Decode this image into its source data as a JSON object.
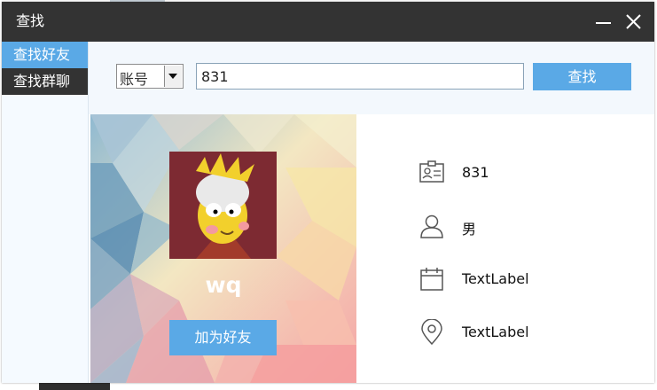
{
  "window": {
    "title": "查找"
  },
  "sidebar": {
    "items": [
      {
        "label": "查找好友",
        "active": true
      },
      {
        "label": "查找群聊",
        "active": false
      }
    ]
  },
  "search": {
    "type_selected": "账号",
    "query": "831",
    "button_label": "查找"
  },
  "profile": {
    "username": "wq",
    "add_button_label": "加为好友"
  },
  "details": {
    "account": "831",
    "gender": "男",
    "birthday": "TextLabel",
    "location": "TextLabel"
  },
  "colors": {
    "titlebar": "#333333",
    "accent": "#5aa9e6",
    "search_area": "#f3f8fd"
  },
  "icons": [
    "minimize-icon",
    "close-icon",
    "dropdown-arrow-icon",
    "id-card-icon",
    "person-icon",
    "calendar-icon",
    "location-pin-icon"
  ]
}
